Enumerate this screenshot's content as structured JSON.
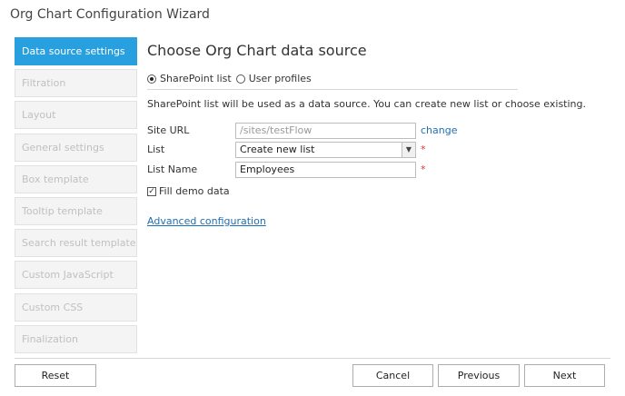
{
  "window": {
    "title": "Org Chart Configuration Wizard"
  },
  "sidebar": {
    "items": [
      {
        "label": "Data source settings",
        "active": true
      },
      {
        "label": "Filtration",
        "active": false
      },
      {
        "label": "Layout",
        "active": false
      },
      {
        "label": "General settings",
        "active": false
      },
      {
        "label": "Box template",
        "active": false
      },
      {
        "label": "Tooltip template",
        "active": false
      },
      {
        "label": "Search result template",
        "active": false
      },
      {
        "label": "Custom JavaScript",
        "active": false
      },
      {
        "label": "Custom CSS",
        "active": false
      },
      {
        "label": "Finalization",
        "active": false
      }
    ]
  },
  "main": {
    "heading": "Choose Org Chart data source",
    "source_options": [
      {
        "label": "SharePoint list",
        "selected": true
      },
      {
        "label": "User profiles",
        "selected": false
      }
    ],
    "description": "SharePoint list will be used as a data source. You can create new list or choose existing.",
    "site_url": {
      "label": "Site URL",
      "value": "/sites/testFlow",
      "change_link": "change"
    },
    "list": {
      "label": "List",
      "value": "Create new list",
      "required_mark": "*"
    },
    "list_name": {
      "label": "List Name",
      "value": "Employees",
      "required_mark": "*"
    },
    "fill_demo": {
      "label": "Fill demo data",
      "checked": true
    },
    "advanced_link": "Advanced configuration"
  },
  "footer": {
    "reset": "Reset",
    "cancel": "Cancel",
    "previous": "Previous",
    "next": "Next"
  },
  "colors": {
    "accent": "#28a0e0",
    "link": "#1f6fb5",
    "required": "#dd3333"
  }
}
